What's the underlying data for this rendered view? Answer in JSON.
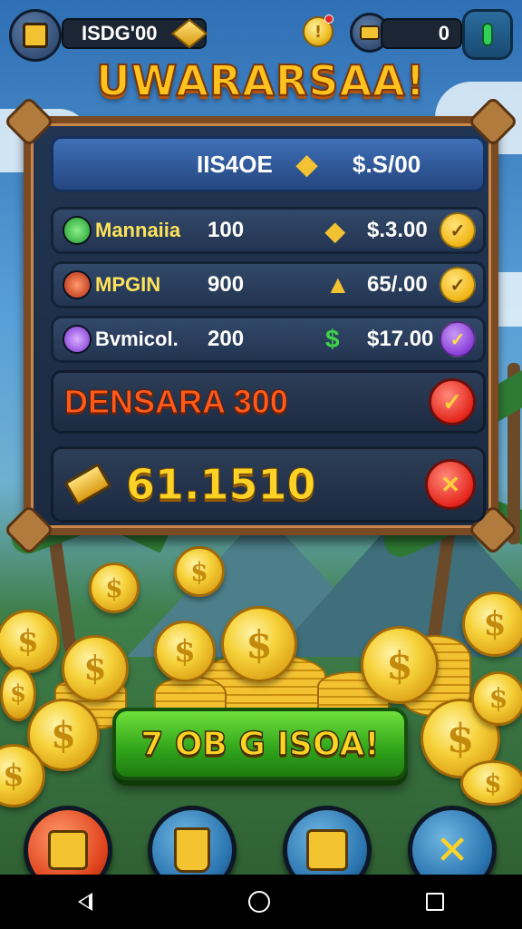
{
  "top_bar": {
    "currency_value": "ISDG'00",
    "gems_value": "0",
    "icons": [
      "scroll-icon",
      "gold-cube-icon",
      "coin-icon",
      "chest-icon",
      "green-bar-icon"
    ]
  },
  "title": "UWARARSAA!",
  "panel": {
    "header": {
      "label": "IIS4OE",
      "price": "$.S/00"
    },
    "items": [
      {
        "name": "Mannaiia",
        "qty": "100",
        "price": "$.3.00",
        "icon": "green-clock-icon",
        "price_icon": "gold-nugget-icon",
        "button_icon": "check-icon"
      },
      {
        "name": "MPGIN",
        "qty": "900",
        "price": "65/.00",
        "icon": "red-orb-icon",
        "price_icon": "gold-bar-icon",
        "button_icon": "check-icon"
      },
      {
        "name": "Bvmicol.",
        "qty": "200",
        "price": "$17.00",
        "icon": "purple-orb-icon",
        "price_icon": "dollar-icon",
        "button_icon": "check-icon"
      }
    ],
    "special": {
      "label": "DENSARA 300",
      "button_icon": "check-icon"
    },
    "total": {
      "value": "61.1510",
      "button_icon": "close-icon"
    }
  },
  "cta": {
    "label": "7 OB G ISOA!"
  },
  "bottom_menu": [
    "puzzle-icon",
    "cup-icon",
    "scroll-icon",
    "tools-icon"
  ],
  "colors": {
    "title": "#ffc21e",
    "panel_bg": "#1b2a40",
    "panel_frame": "#7a4a22",
    "cta_green": "#2fa31a",
    "accent_gold": "#ffd326",
    "danger_red": "#e5261d"
  }
}
